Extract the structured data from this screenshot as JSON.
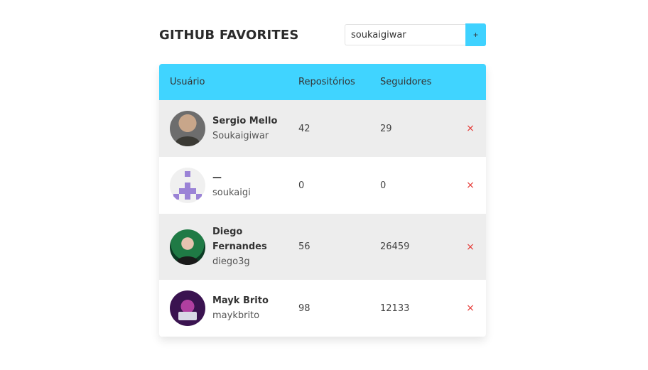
{
  "header": {
    "title": "GITHUB FAVORITES",
    "search_value": "soukaigiwar",
    "add_label": "+"
  },
  "table": {
    "columns": [
      "Usuário",
      "Repositórios",
      "Seguidores"
    ],
    "rows": [
      {
        "name": "Sergio Mello",
        "login": "Soukaigiwar",
        "repos": "42",
        "followers": "29",
        "remove": "×"
      },
      {
        "name": "—",
        "login": "soukaigi",
        "repos": "0",
        "followers": "0",
        "remove": "×"
      },
      {
        "name": "Diego Fernandes",
        "login": "diego3g",
        "repos": "56",
        "followers": "26459",
        "remove": "×"
      },
      {
        "name": "Mayk Brito",
        "login": "maykbrito",
        "repos": "98",
        "followers": "12133",
        "remove": "×"
      }
    ]
  },
  "colors": {
    "accent": "#40d4ff",
    "row_alt": "#ededed",
    "remove": "#e53935"
  },
  "icons": {
    "remove": "close-icon",
    "add": "plus-icon"
  }
}
